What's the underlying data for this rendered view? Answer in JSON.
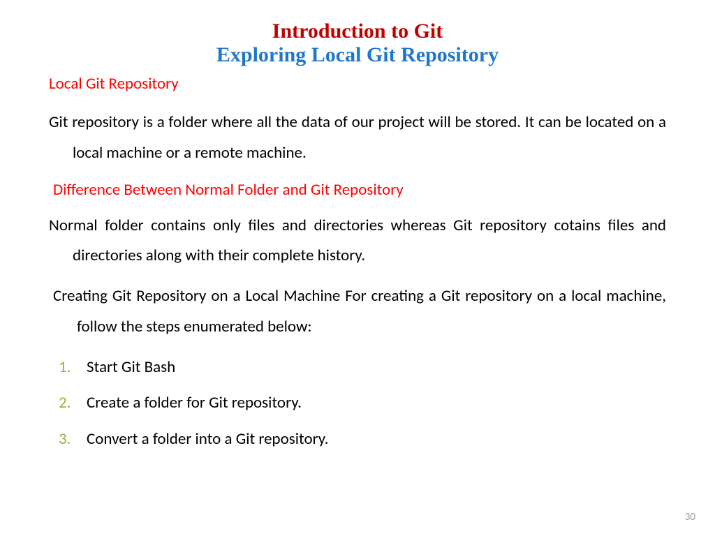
{
  "title_main": "Introduction to Git",
  "title_sub": "Exploring Local Git Repository",
  "heading1": "Local Git Repository",
  "para1": "Git repository is a folder where all the data of our project will be stored. It can be located on a local machine or a remote machine.",
  "heading2": "Difference Between Normal Folder and Git Repository",
  "para2": "Normal folder contains only files and directories whereas Git repository cotains files and directories along with their complete history.",
  "para3": "Creating Git Repository on a Local Machine For creating a Git repository on a local machine, follow the steps enumerated below:",
  "steps": {
    "0": "Start Git Bash",
    "1": "Create a folder for Git repository.",
    "2": "Convert a folder into a Git repository."
  },
  "page_number": "30"
}
